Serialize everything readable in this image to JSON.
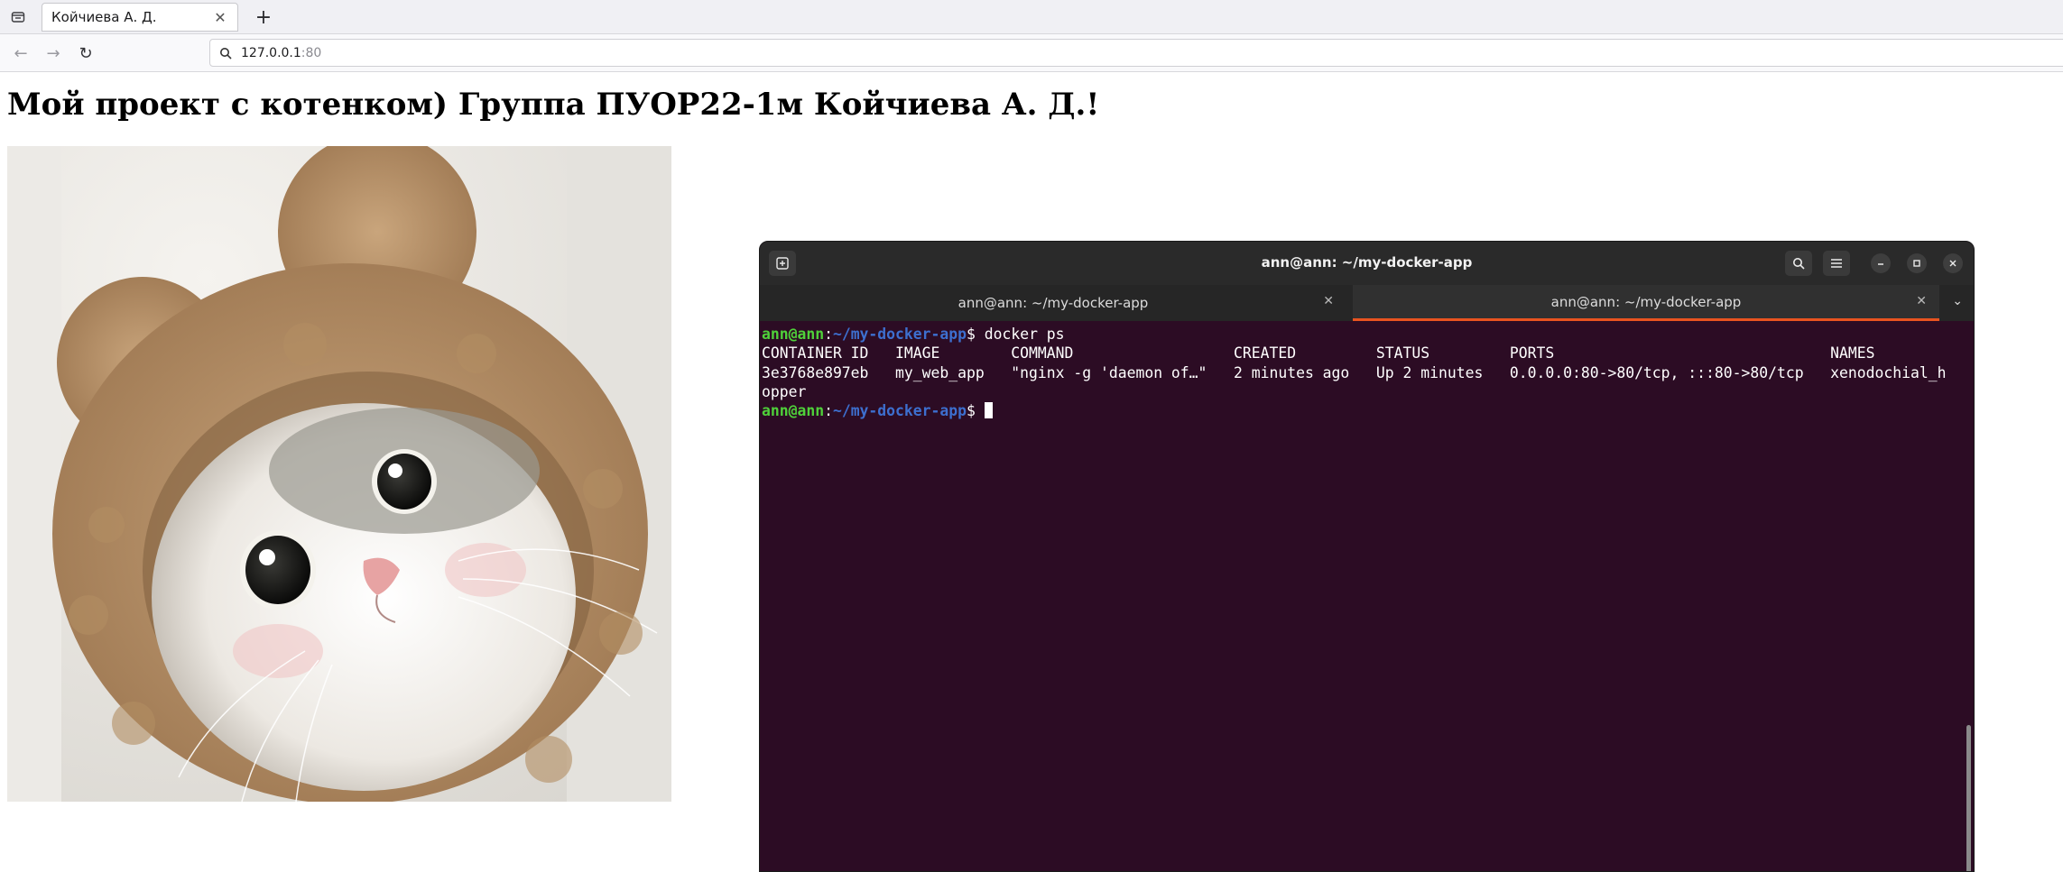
{
  "browser": {
    "tab": {
      "title": "Койчиева А. Д.",
      "close_glyph": "✕"
    },
    "new_tab_glyph": "+",
    "nav": {
      "back_glyph": "←",
      "forward_glyph": "→",
      "reload_glyph": "↻"
    },
    "url": {
      "host": "127.0.0.1",
      "port": ":80"
    }
  },
  "page": {
    "heading": "Мой проект с котенком) Группа ПУОР22-1м Койчиева А. Д.!"
  },
  "terminal": {
    "title": "ann@ann: ~/my-docker-app",
    "tabs": [
      {
        "label": "ann@ann: ~/my-docker-app"
      },
      {
        "label": "ann@ann: ~/my-docker-app"
      }
    ],
    "prompt": {
      "user": "ann@ann",
      "sep": ":",
      "path": "~/my-docker-app",
      "symbol": "$"
    },
    "command": " docker ps",
    "output": [
      "CONTAINER ID   IMAGE        COMMAND                  CREATED         STATUS         PORTS                               NAMES",
      "3e3768e897eb   my_web_app   \"nginx -g 'daemon of…\"   2 minutes ago   Up 2 minutes   0.0.0.0:80->80/tcp, :::80->80/tcp   xenodochial_h",
      "opper"
    ]
  }
}
